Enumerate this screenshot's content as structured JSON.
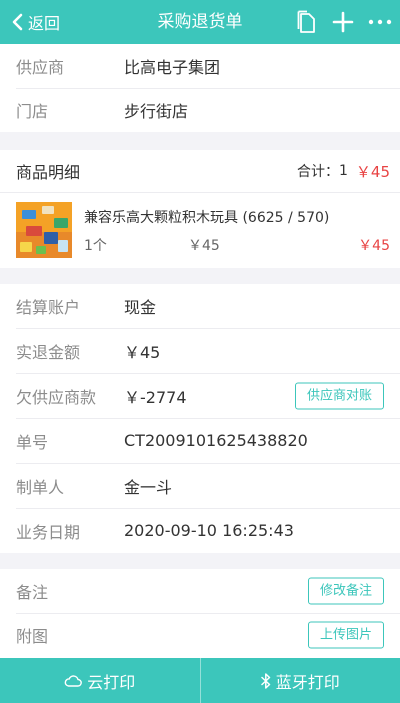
{
  "header": {
    "back_label": "返回",
    "title": "采购退货单",
    "icons": [
      "document-icon",
      "plus-icon",
      "more-icon"
    ]
  },
  "info": {
    "supplier_label": "供应商",
    "supplier_value": "比高电子集团",
    "store_label": "门店",
    "store_value": "步行街店"
  },
  "goods": {
    "title": "商品明细",
    "total_label": "合计：",
    "total_count": "1",
    "total_amount": "￥45",
    "items": [
      {
        "name": "兼容乐高大颗粒积木玩具 (6625 / 570)",
        "qty": "1个",
        "price": "￥45",
        "subtotal": "￥45"
      }
    ]
  },
  "settlement": {
    "account_label": "结算账户",
    "account_value": "现金",
    "refund_label": "实退金额",
    "refund_value": "￥45",
    "owed_label": "欠供应商款",
    "owed_value": "￥-2774",
    "reconcile_button": "供应商对账",
    "order_no_label": "单号",
    "order_no_value": "CT2009101625438820",
    "creator_label": "制单人",
    "creator_value": "金一斗",
    "date_label": "业务日期",
    "date_value": "2020-09-10 16:25:43"
  },
  "extra": {
    "note_label": "备注",
    "edit_note_button": "修改备注",
    "attachment_label": "附图",
    "upload_button": "上传图片"
  },
  "footer": {
    "cloud_print": "云打印",
    "bluetooth_print": "蓝牙打印"
  },
  "colors": {
    "accent": "#3cc6bb",
    "price_red": "#e84343",
    "background": "#f3f3f7"
  }
}
